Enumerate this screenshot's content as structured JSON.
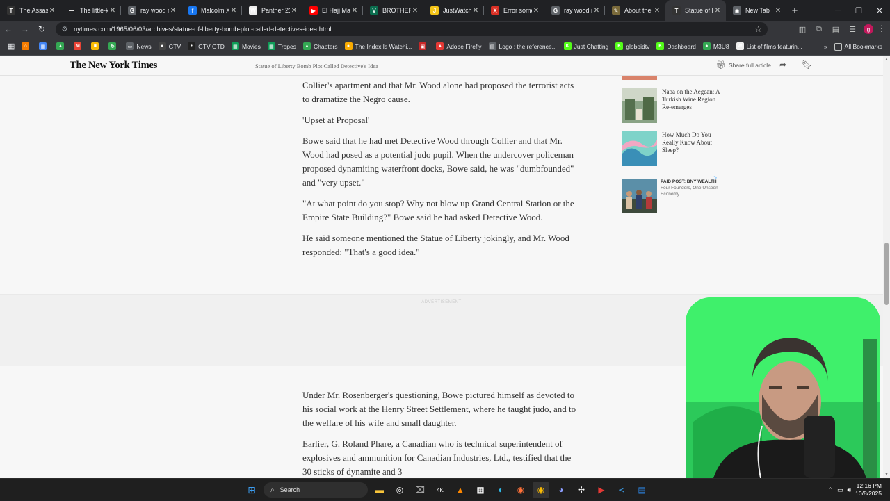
{
  "tabs": [
    {
      "title": "The Assassin",
      "icon": "nyt-icon",
      "color": "#333333",
      "glyph": "T"
    },
    {
      "title": "The little-kn",
      "icon": "dash-icon",
      "color": "#202124",
      "glyph": "—"
    },
    {
      "title": "ray wood n",
      "icon": "google-icon",
      "color": "#5f6368",
      "glyph": "G"
    },
    {
      "title": "Malcolm X",
      "icon": "facebook-icon",
      "color": "#1877f2",
      "glyph": "f"
    },
    {
      "title": "Panther 21",
      "icon": "wikipedia-icon",
      "color": "#eeeeee",
      "glyph": "W"
    },
    {
      "title": "El Hajj Mal",
      "icon": "youtube-icon",
      "color": "#ff0000",
      "glyph": "▶"
    },
    {
      "title": "BROTHER",
      "icon": "vocal-icon",
      "color": "#0b6e4f",
      "glyph": "V"
    },
    {
      "title": "JustWatch",
      "icon": "justwatch-icon",
      "color": "#f5c518",
      "glyph": "J"
    },
    {
      "title": "Error some",
      "icon": "error-x-icon",
      "color": "#d93025",
      "glyph": "X"
    },
    {
      "title": "ray wood n",
      "icon": "google-icon",
      "color": "#5f6368",
      "glyph": "G"
    },
    {
      "title": "About the",
      "icon": "quill-icon",
      "color": "#7a6a3a",
      "glyph": "✎"
    },
    {
      "title": "Statue of L",
      "icon": "nyt-icon",
      "color": "#333333",
      "glyph": "T",
      "active": true
    },
    {
      "title": "New Tab",
      "icon": "chrome-icon",
      "color": "#5f6368",
      "glyph": "◉"
    }
  ],
  "url": "nytimes.com/1965/06/03/archives/statue-of-liberty-bomb-plot-called-detectives-idea.html",
  "bookmarks": [
    {
      "label": "",
      "icon": "home-icon",
      "color": "#f57c00",
      "glyph": "⌂"
    },
    {
      "label": "",
      "icon": "calendar-icon",
      "color": "#4285f4",
      "glyph": "▦"
    },
    {
      "label": "",
      "icon": "drive-icon",
      "color": "#34a853",
      "glyph": "▲"
    },
    {
      "label": "",
      "icon": "gmail-icon",
      "color": "#ea4335",
      "glyph": "M"
    },
    {
      "label": "",
      "icon": "keep-icon",
      "color": "#fbbc04",
      "glyph": "■"
    },
    {
      "label": "",
      "icon": "refresh-ext-icon",
      "color": "#34a853",
      "glyph": "↻"
    },
    {
      "label": "News",
      "icon": "folder-icon",
      "color": "#5f6368",
      "glyph": "▭"
    },
    {
      "label": "GTV",
      "icon": "github-icon",
      "color": "#444444",
      "glyph": "●"
    },
    {
      "label": "GTV GTD",
      "icon": "gtv-icon",
      "color": "#222222",
      "glyph": "•"
    },
    {
      "label": "Movies",
      "icon": "sheets-icon",
      "color": "#0f9d58",
      "glyph": "▦"
    },
    {
      "label": "Tropes",
      "icon": "sheets-icon",
      "color": "#0f9d58",
      "glyph": "▦"
    },
    {
      "label": "Chapters",
      "icon": "drive-icon",
      "color": "#34a853",
      "glyph": "▲"
    },
    {
      "label": "The Index Is Watchi...",
      "icon": "bulb-icon",
      "color": "#f9ab00",
      "glyph": "●"
    },
    {
      "label": "",
      "icon": "red-ext-icon",
      "color": "#c62828",
      "glyph": "▣"
    },
    {
      "label": "Adobe Firefly",
      "icon": "firefly-icon",
      "color": "#e53935",
      "glyph": "▲"
    },
    {
      "label": "Logo : the reference...",
      "icon": "page-icon",
      "color": "#5f6368",
      "glyph": "▤"
    },
    {
      "label": "Just Chatting",
      "icon": "kick-icon",
      "color": "#53fc18",
      "glyph": "K"
    },
    {
      "label": "globoidtv",
      "icon": "kick-icon",
      "color": "#53fc18",
      "glyph": "K"
    },
    {
      "label": "Dashboard",
      "icon": "kick-icon",
      "color": "#53fc18",
      "glyph": "K"
    },
    {
      "label": "M3U8",
      "icon": "m3u8-icon",
      "color": "#34a853",
      "glyph": "●"
    },
    {
      "label": "List of films featurin...",
      "icon": "wikipedia-icon",
      "color": "#eeeeee",
      "glyph": "W"
    }
  ],
  "all_bookmarks": "All Bookmarks",
  "nyt": {
    "logo": "The New York Times",
    "header_title": "Statue of Liberty Bomb Plot Called Detective's Idea",
    "share_full": "Share full article"
  },
  "article": {
    "p1": "Collier's apartment and that Mr. Wood alone had proposed the terrorist acts to dramatize the Negro cause.",
    "subhead": "'Upset at Proposal'",
    "p2": "Bowe said that he had met Detective Wood through Collier and that Mr. Wood had posed as a potential judo pupil. When the undercover policeman proposed dynamiting waterfront docks, Bowe said, he was \"dumbfounded\" and \"very upset.\"",
    "p3": "\"At what point do you stop? Why not blow up Grand Central Station or the Empire State Building?\" Bowe said he had asked Detective Wood.",
    "p4": "He said someone mentioned the Statue of Liberty jokingly, and Mr. Wood responded: \"That's a good idea.\"",
    "p5": "Under Mr. Rosenberger's questioning, Bowe pictured himself as devoted to his social work at the Henry Street Settlement, where he taught judo, and to the welfare of his wife and small daughter.",
    "p6": "Earlier, G. Roland Phare, a Canadian who is technical superintendent of explosives and ammunition for Canadian Industries, Ltd., testified that the 30 sticks of dynamite and 3"
  },
  "ad_label": "ADVERTISEMENT",
  "sidebar": {
    "card1": "Napa on the Aegean: A Turkish Wine Region Re-emerges",
    "card2": "How Much Do You Really Know About Sleep?",
    "paid_label": "PAID POST: BNY WEALTH",
    "paid_text": "Four Founders, One Unseen Economy"
  },
  "taskbar": {
    "search": "Search",
    "time": "12:16 PM",
    "date": "10/8/2025"
  }
}
